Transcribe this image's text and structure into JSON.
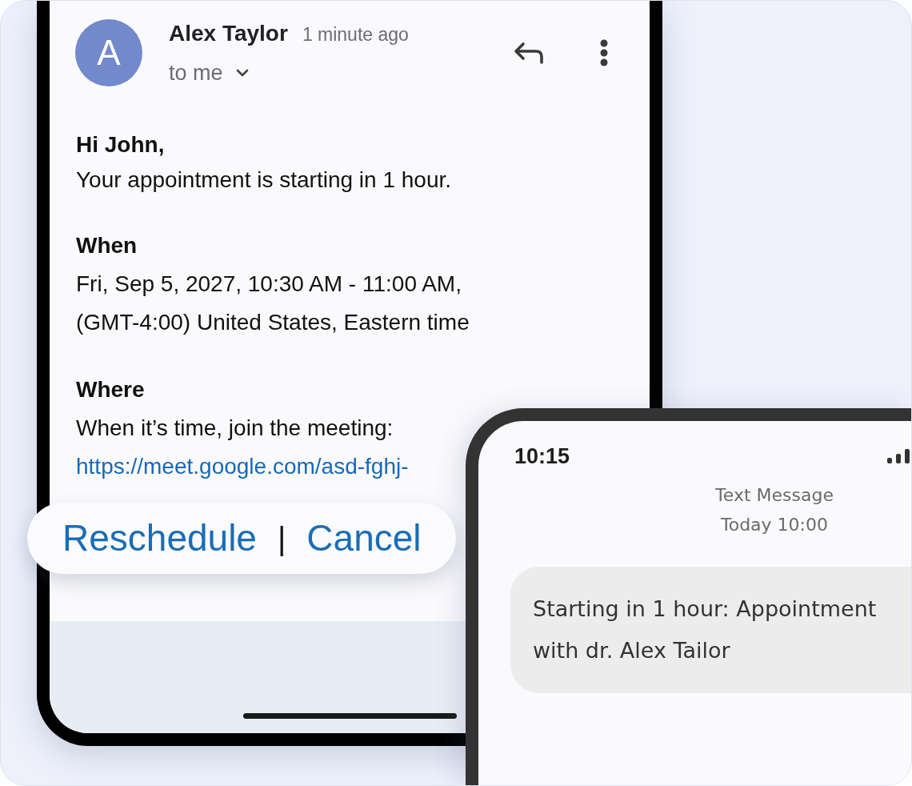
{
  "email": {
    "avatar_initial": "A",
    "sender": "Alex Taylor",
    "time": "1 minute ago",
    "recipient": "to me",
    "greeting": "Hi John,",
    "intro": "Your appointment is starting in 1 hour.",
    "sections": [
      {
        "heading": "When",
        "lines": [
          "Fri, Sep 5, 2027, 10:30 AM - 11:00 AM,",
          "(GMT-4:00) United States, Eastern time"
        ]
      },
      {
        "heading": "Where",
        "lines": [
          "When it’s time, join the meeting:"
        ],
        "link": "https://meet.google.com/asd-fghj-"
      }
    ]
  },
  "actions": {
    "items": [
      {
        "label": "Reschedule"
      },
      {
        "label": "Cancel"
      }
    ],
    "separator": "|"
  },
  "sms": {
    "clock": "10:15",
    "title": "Text Message",
    "date": "Today 10:00",
    "messages": [
      {
        "text": "Starting in 1 hour: Appointment with dr. Alex Tailor"
      }
    ]
  }
}
